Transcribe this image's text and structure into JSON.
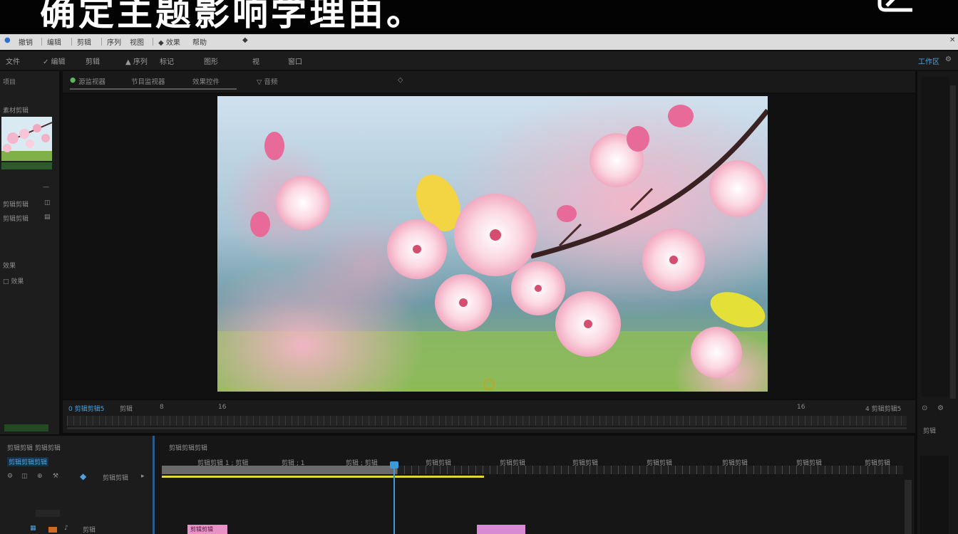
{
  "banner": {
    "title": "确定主题影响学理由。"
  },
  "menubar": {
    "items": [
      "撤销",
      "编辑",
      "剪辑",
      "序列",
      "视图",
      "◆ 效果",
      "帮助",
      "◆"
    ]
  },
  "toolbar": {
    "items": [
      "文件",
      "✓ 编辑",
      "剪辑",
      "▲ 序列",
      "标记",
      "图形",
      "视",
      "窗口"
    ],
    "right_label": "工作区"
  },
  "left_panel": {
    "title": "项目",
    "media_label": "素材剪辑",
    "items": [
      "剪辑剪辑",
      "剪辑剪辑",
      "效果",
      "□ 效果"
    ]
  },
  "viewer": {
    "tabs": [
      "源监视器",
      "节目监视器",
      "效果控件",
      "▽ 音频",
      "◇"
    ],
    "image_alt": "cherry blossom branch"
  },
  "scrub": {
    "left": "0 剪辑剪辑5",
    "a": "剪辑",
    "b": "8",
    "c": "16",
    "right1": "16",
    "right2": "4 剪辑剪辑5"
  },
  "timeline": {
    "seq_name": "剪辑剪辑 剪辑剪辑",
    "seq_tab": "剪辑剪辑剪辑",
    "track_label": "剪辑剪辑",
    "header": "剪辑剪辑剪辑",
    "timecodes": [
      "剪辑剪辑 1 ; 剪辑",
      "剪辑 ; 1",
      "剪辑 ; 剪辑"
    ],
    "ruler": [
      "剪辑剪辑",
      "剪辑剪辑",
      "剪辑剪辑",
      "剪辑剪辑",
      "剪辑剪辑",
      "剪辑剪辑",
      "剪辑剪辑"
    ],
    "clip1": "剪辑剪辑",
    "bottom": "剪辑"
  },
  "right_panel": {
    "label": "剪辑"
  },
  "colors": {
    "accent": "#4aa3df",
    "yellow": "#e6d63a",
    "clip_pink": "#e892c8"
  }
}
